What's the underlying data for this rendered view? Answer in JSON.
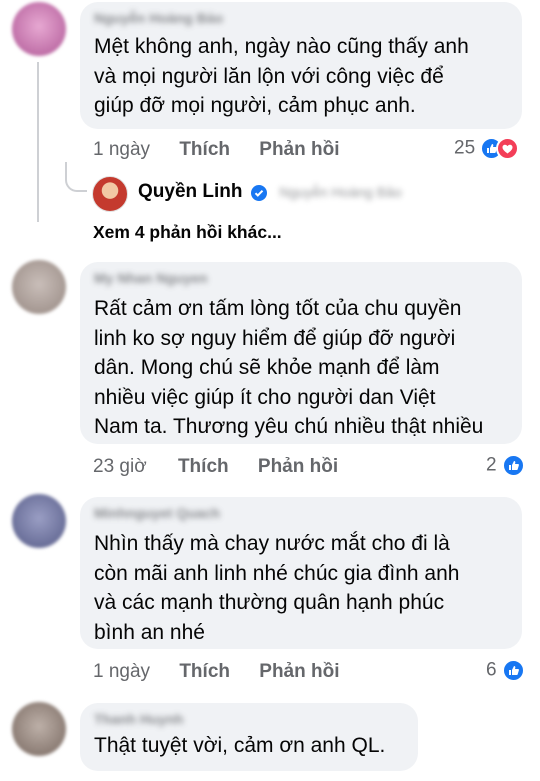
{
  "comments": [
    {
      "author": "Nguyễn Hoàng Bảo",
      "text": "Mệt không anh, ngày nào cũng thấy anh\nvà mọi người lăn lộn với công việc để\ngiúp đỡ mọi người, cảm phục anh.",
      "time": "1 ngày",
      "like": "Thích",
      "reply": "Phản hồi",
      "reactions": "25",
      "avatar_color": "#d07fb6",
      "reaction_icons": [
        "like-icon",
        "love-icon"
      ]
    },
    {
      "author": "My Nhan Nguyen",
      "text": "Rất cảm ơn tấm lòng tốt của chu quyền\nlinh ko sợ nguy hiểm để giúp đỡ người\ndân. Mong chú sẽ khỏe mạnh để làm\nnhiều việc giúp ít cho người dan Việt\nNam ta. Thương yêu chú nhiều thật nhiều",
      "time": "23 giờ",
      "like": "Thích",
      "reply": "Phản hồi",
      "reactions": "2",
      "avatar_color": "#b7ada9",
      "reaction_icons": [
        "like-icon"
      ]
    },
    {
      "author": "Minhnguyet Quach",
      "text": "Nhìn thấy mà chay nước mắt cho đi là\ncòn mãi anh linh nhé chúc gia đình anh\nvà các mạnh thường quân hạnh phúc\nbình an nhé",
      "time": "1 ngày",
      "like": "Thích",
      "reply": "Phản hồi",
      "reactions": "6",
      "avatar_color": "#7a7fa8",
      "reaction_icons": [
        "like-icon"
      ]
    },
    {
      "author": "Thanh Huynh",
      "text": "Thật tuyệt vời, cảm ơn anh QL.",
      "avatar_color": "#9e9089"
    }
  ],
  "reply_preview": {
    "author": "Quyền Linh",
    "verified_icon": "verified-badge-icon",
    "reply_to": "Nguyễn Hoàng Bảo",
    "avatar_color": "#c43a2e"
  },
  "more_replies": "Xem 4 phản hồi khác...",
  "colors": {
    "bubble": "#f0f2f5",
    "like_blue": "#1877f2",
    "love_red": "#f33e58",
    "meta_gray": "#65676b"
  }
}
